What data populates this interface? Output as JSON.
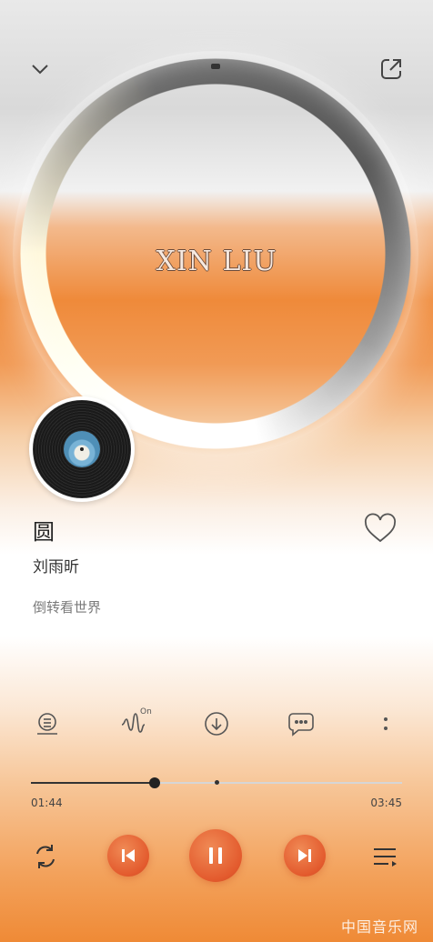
{
  "header": {
    "collapse_icon": "chevron-down-icon",
    "share_icon": "share-icon"
  },
  "artwork": {
    "text": "XIN LIU"
  },
  "song": {
    "title": "圆",
    "artist": "刘雨昕",
    "lyric": "倒转看世界"
  },
  "actions": {
    "items": [
      "lyrics-icon",
      "sound-effect-icon",
      "download-icon",
      "comment-icon",
      "more-icon"
    ],
    "sound_badge": "On"
  },
  "progress": {
    "current": "01:44",
    "total": "03:45",
    "played_fraction": 0.333,
    "buffered_fraction": 0.5
  },
  "controls": {
    "repeat": "repeat-icon",
    "prev": "prev-icon",
    "play": "pause-icon",
    "next": "next-icon",
    "queue": "queue-icon"
  },
  "watermark": "中国音乐网",
  "colors": {
    "accent": "#e35a2d",
    "text": "#222222",
    "muted": "#7a7a7a"
  }
}
